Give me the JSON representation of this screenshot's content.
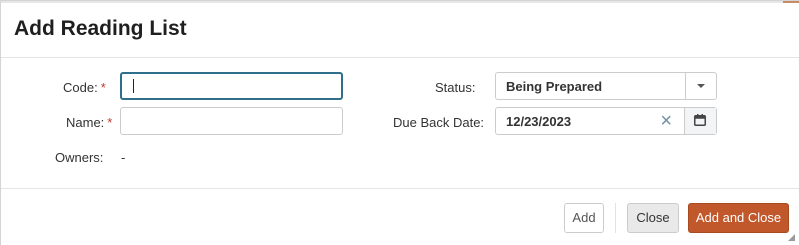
{
  "dialog": {
    "title": "Add Reading List"
  },
  "form": {
    "code_label": "Code:",
    "name_label": "Name:",
    "owners_label": "Owners:",
    "owners_value": "-",
    "status_label": "Status:",
    "status_value": "Being Prepared",
    "due_back_date_label": "Due Back Date:",
    "due_back_date_value": "12/23/2023",
    "required_marker": "*",
    "code_value": "",
    "name_value": ""
  },
  "footer": {
    "add_label": "Add",
    "close_label": "Close",
    "add_and_close_label": "Add and Close"
  },
  "icons": {
    "status_dropdown": "chevron-down-icon",
    "clear_date": "close-icon",
    "calendar": "calendar-icon",
    "resize": "resize-handle-icon"
  },
  "colors": {
    "primary_button": "#c1582b",
    "focus_border": "#2f6f8c",
    "required": "#c0392b"
  }
}
